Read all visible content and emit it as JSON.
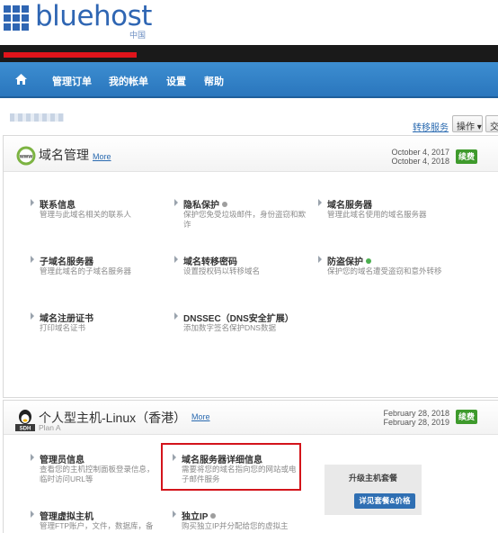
{
  "brand": {
    "name": "bluehost",
    "sub": "中国",
    "accent": "#2f66b3"
  },
  "nav": {
    "items": [
      {
        "label": "管理订单"
      },
      {
        "label": "我的帐单"
      },
      {
        "label": "设置"
      },
      {
        "label": "帮助"
      }
    ]
  },
  "toolbar": {
    "transfer_label": "转移服务",
    "ops_label": "操作 ▾",
    "exchange_label": "交"
  },
  "domain_section": {
    "title": "域名管理",
    "more": "More",
    "dates": [
      "October 4, 2017",
      "October 4, 2018"
    ],
    "renew": "续费",
    "icon": "www-globe-icon",
    "items": [
      {
        "title": "联系信息",
        "desc": "管理与此域名相关的联系人"
      },
      {
        "title": "隐私保护",
        "desc": "保护您免受垃圾邮件，身份盗窃和欺诈",
        "status": "gray"
      },
      {
        "title": "域名服务器",
        "desc": "管理此域名使用的域名服务器"
      },
      {
        "title": "子域名服务器",
        "desc": "管理此域名的子域名服务器"
      },
      {
        "title": "域名转移密码",
        "desc": "设置授权码以转移域名"
      },
      {
        "title": "防盗保护",
        "desc": "保护您的域名遭受盗窃和意外转移",
        "status": "green"
      },
      {
        "title": "域名注册证书",
        "desc": "打印域名证书"
      },
      {
        "title": "DNSSEC（DNS安全扩展）",
        "desc": "添加数字签名保护DNS数据"
      }
    ]
  },
  "hosting_section": {
    "title": "个人型主机-Linux（香港）",
    "more": "More",
    "plan": "Plan A",
    "dates": [
      "February 28, 2018",
      "February 28, 2019"
    ],
    "renew": "续费",
    "icon": "sdh-server-icon",
    "icon_label": "SDH",
    "items": [
      {
        "title": "管理员信息",
        "desc": "查看您的主机控制面板登录信息，临时访问URL等"
      },
      {
        "title": "域名服务器详细信息",
        "desc": "需要将您的域名指向您的网站或电子邮件服务"
      },
      {
        "title": "管理虚拟主机",
        "desc": "管理FTP账户，文件，数据库，备"
      },
      {
        "title": "独立IP",
        "desc": "购买独立IP并分配给您的虚拟主",
        "status": "gray"
      }
    ],
    "upgrade": {
      "title": "升级主机套餐",
      "button": "详见套餐&价格"
    }
  },
  "colors": {
    "nav_bg": "#2a76bd",
    "renew_green": "#3e9a2c",
    "highlight_red": "#d3141b",
    "link_blue": "#2a6ab0"
  }
}
